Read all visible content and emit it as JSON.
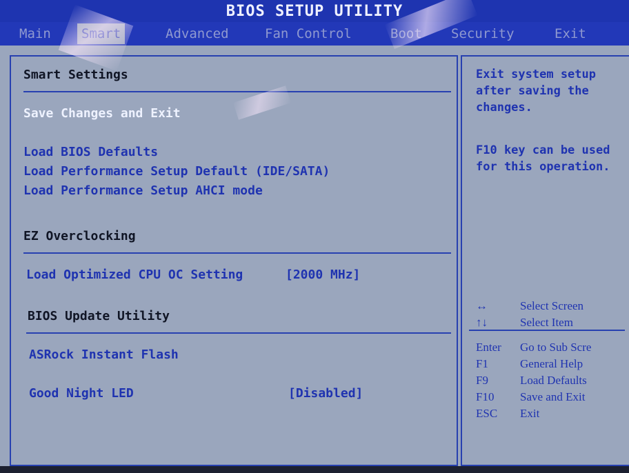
{
  "title": "BIOS SETUP UTILITY",
  "menu": [
    {
      "label": "Main"
    },
    {
      "label": "Smart"
    },
    {
      "label": "Advanced"
    },
    {
      "label": "Fan Control"
    },
    {
      "label": "Boot"
    },
    {
      "label": "Security"
    },
    {
      "label": "Exit"
    }
  ],
  "active_tab": "Smart",
  "main": {
    "smart_settings_heading": "Smart Settings",
    "save_changes_exit": "Save Changes and Exit",
    "load_bios_defaults": "Load BIOS Defaults",
    "load_perf_ide": "Load Performance Setup Default (IDE/SATA)",
    "load_perf_ahci": "Load Performance Setup AHCI mode",
    "ez_overclocking_heading": "EZ Overclocking",
    "load_optimized_cpu": "Load Optimized CPU OC Setting",
    "load_optimized_cpu_value": "[2000 MHz]",
    "bios_update_heading": "BIOS Update Utility",
    "asrock_instant_flash": "ASRock Instant Flash",
    "good_night_led": "Good Night LED",
    "good_night_led_value": "[Disabled]"
  },
  "help": {
    "line1": "Exit system setup",
    "line2": "after saving the",
    "line3": "changes.",
    "line4": "F10 key can be used",
    "line5": "for this operation.",
    "keys": [
      {
        "key": "↔",
        "desc": "Select Screen"
      },
      {
        "key": "↑↓",
        "desc": "Select Item"
      },
      {
        "key": "Enter",
        "desc": "Go to Sub Scre"
      },
      {
        "key": "F1",
        "desc": "General Help"
      },
      {
        "key": "F9",
        "desc": "Load Defaults"
      },
      {
        "key": "F10",
        "desc": "Save and Exit"
      },
      {
        "key": "ESC",
        "desc": "Exit"
      }
    ]
  },
  "colors": {
    "background": "#9aa6bd",
    "menu_bar": "#2238b8",
    "item_text": "#1f33b0",
    "selected_text": "#eef2ff",
    "heading_text": "#101525"
  }
}
